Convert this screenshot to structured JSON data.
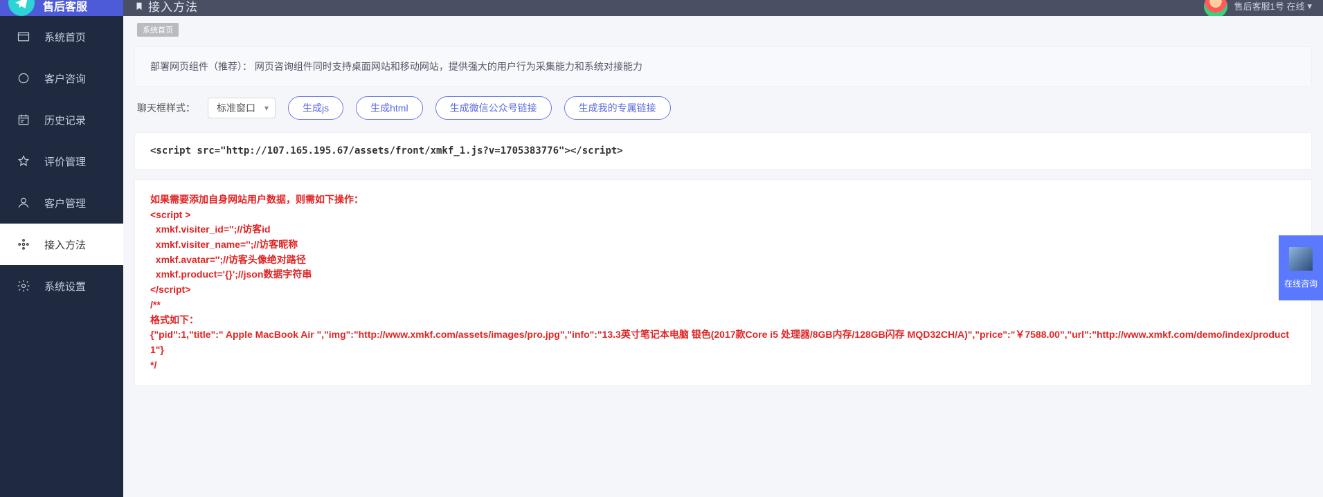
{
  "brand": "售后客服",
  "page_title": "接入方法",
  "user_status": "售后客服1号 在线",
  "breadcrumb": "系统首页",
  "sidebar": {
    "items": [
      {
        "label": "系统首页",
        "name": "sidebar-item-home"
      },
      {
        "label": "客户咨询",
        "name": "sidebar-item-consult"
      },
      {
        "label": "历史记录",
        "name": "sidebar-item-history"
      },
      {
        "label": "评价管理",
        "name": "sidebar-item-review"
      },
      {
        "label": "客户管理",
        "name": "sidebar-item-customer"
      },
      {
        "label": "接入方法",
        "name": "sidebar-item-access"
      },
      {
        "label": "系统设置",
        "name": "sidebar-item-settings"
      }
    ]
  },
  "info_notice": "部署网页组件（推荐）：  网页咨询组件同时支持桌面网站和移动网站，提供强大的用户行为采集能力和系统对接能力",
  "controls": {
    "label": "聊天框样式：",
    "select_value": "标准窗口",
    "btn_js": "生成js",
    "btn_html": "生成html",
    "btn_wechat": "生成微信公众号链接",
    "btn_mine": "生成我的专属链接"
  },
  "script_snippet": "<script src=\"http://107.165.195.67/assets/front/xmkf_1.js?v=1705383776\"></script>",
  "red_note": "如果需要添加自身网站用户数据，则需如下操作：\n<script >\n  xmkf.visiter_id='';//访客id\n  xmkf.visiter_name='';//访客昵称\n  xmkf.avatar='';//访客头像绝对路径\n  xmkf.product='{}';//json数据字符串\n</script>\n/**\n格式如下：\n{\"pid\":1,\"title\":\" Apple MacBook Air \",\"img\":\"http://www.xmkf.com/assets/images/pro.jpg\",\"info\":\"13.3英寸笔记本电脑 银色(2017款Core i5 处理器/8GB内存/128GB闪存 MQD32CH/A)\",\"price\":\"￥7588.00\",\"url\":\"http://www.xmkf.com/demo/index/product1\"}\n*/",
  "float_label": "在线咨询"
}
